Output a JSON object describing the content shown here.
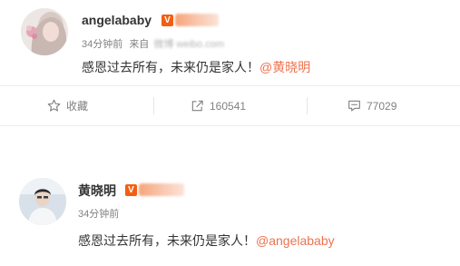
{
  "post1": {
    "author": "angelababy",
    "verified_mark": "V",
    "time": "34分钟前",
    "source_prefix": "来自",
    "source_blurred": "微博 weibo.com",
    "text": "感恩过去所有，未来仍是家人！",
    "mention": "@黄晓明",
    "actions": {
      "favorite_label": "收藏",
      "repost_count": "160541",
      "comment_count": "77029"
    }
  },
  "post2": {
    "author": "黄晓明",
    "verified_mark": "V",
    "time": "34分钟前",
    "text": "感恩过去所有，未来仍是家人！",
    "mention": "@angelababy"
  },
  "colors": {
    "mention": "#eb7350",
    "verified": "#f25f13",
    "meta_text": "#808080"
  }
}
